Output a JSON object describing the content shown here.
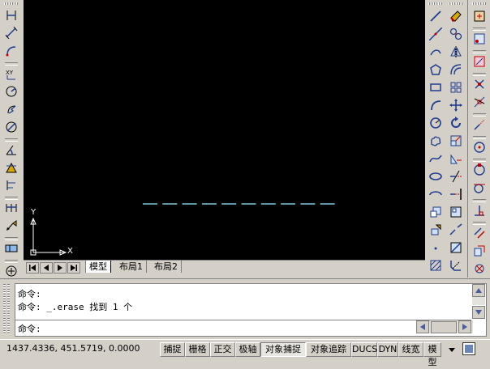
{
  "layout_tabs": {
    "model": "模型",
    "layout1": "布局1",
    "layout2": "布局2"
  },
  "canvas": {
    "ucs_x_label": "X",
    "ucs_y_label": "Y",
    "background": "#000000",
    "line_color": "#7fc8d8"
  },
  "command": {
    "line1": "命令:",
    "line2": "命令: _.erase 找到 1 个",
    "prompt": "命令:"
  },
  "status": {
    "coordinates": "1437.4336, 451.5719, 0.0000",
    "buttons": [
      "捕捉",
      "栅格",
      "正交",
      "极轴",
      "对象捕捉",
      "对象追踪",
      "DUCS",
      "DYN",
      "线宽",
      "模型"
    ]
  },
  "icons": {
    "left_toolbar": [
      "linear-dimension-icon",
      "aligned-dimension-icon",
      "arc-length-icon",
      "ordinate-dimension-icon",
      "radius-dimension-icon",
      "jogged-dimension-icon",
      "diameter-dimension-icon",
      "angular-dimension-icon",
      "quick-dimension-icon",
      "baseline-dimension-icon",
      "continue-dimension-icon",
      "quick-leader-icon",
      "tolerance-icon",
      "center-mark-icon"
    ],
    "draw_toolbar": [
      "line-icon",
      "construction-line-icon",
      "polyline-icon",
      "polygon-icon",
      "rectangle-icon",
      "arc-icon",
      "circle-icon",
      "revision-cloud-icon",
      "spline-icon",
      "ellipse-icon",
      "ellipse-arc-icon",
      "insert-block-icon",
      "make-block-icon",
      "point-icon",
      "hatch-icon"
    ],
    "modify_toolbar": [
      "erase-icon",
      "copy-icon",
      "mirror-icon",
      "offset-icon",
      "array-icon",
      "move-icon",
      "rotate-icon",
      "scale-icon",
      "stretch-icon",
      "trim-icon",
      "extend-icon",
      "break-at-point-icon",
      "break-icon",
      "join-icon",
      "chamfer-icon"
    ],
    "right_toolbar": [
      "object-snap-settings-icon",
      "snap-to-endpoint-icon",
      "snap-to-midpoint-icon",
      "snap-to-intersection-icon",
      "snap-to-apparent-icon",
      "snap-to-extension-icon",
      "snap-to-center-icon",
      "snap-to-quadrant-icon",
      "snap-to-tangent-icon",
      "snap-to-perpendicular-icon",
      "snap-to-parallel-icon",
      "snap-to-insert-icon",
      "snap-to-node-icon",
      "snap-to-nearest-icon"
    ]
  }
}
